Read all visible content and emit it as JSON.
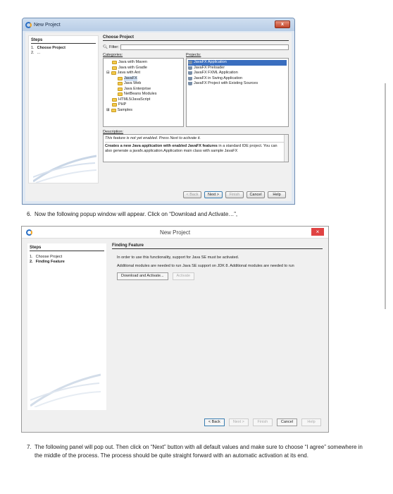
{
  "window1": {
    "title": "New Project",
    "close_label": "x",
    "steps_header": "Steps",
    "steps": [
      {
        "num": "1.",
        "label": "Choose Project"
      },
      {
        "num": "2.",
        "label": "..."
      }
    ],
    "main_header": "Choose Project",
    "filter_label": "Filter:",
    "categories_label": "Categories:",
    "projects_label": "Projects:",
    "categories": [
      "Java with Maven",
      "Java with Gradle",
      "Java with Ant",
      "JavaFX",
      "Java Web",
      "Java Enterprise",
      "NetBeans Modules",
      "HTML5/JavaScript",
      "PHP",
      "Samples"
    ],
    "projects": [
      "JavaFX Application",
      "JavaFX Preloader",
      "JavaFX FXML Application",
      "JavaFX in Swing Application",
      "JavaFX Project with Existing Sources"
    ],
    "description_label": "Description:",
    "description_note": "This feature is not yet enabled. Press Next to activate it.",
    "description_bold": "Creates a new Java application with enabled JavaFX features",
    "description_rest": " in a standard IDE project. You can also generate a javafx.application.Application main class with sample JavaFX",
    "buttons": {
      "back": "< Back",
      "next": "Next >",
      "finish": "Finish",
      "cancel": "Cancel",
      "help": "Help"
    }
  },
  "step6": {
    "num": "6.",
    "text": "Now the following popup window will appear. Click on “Download and Activate…”,"
  },
  "window2": {
    "title": "New Project",
    "close_label": "×",
    "steps_header": "Steps",
    "steps": [
      {
        "num": "1.",
        "label": "Choose Project"
      },
      {
        "num": "2.",
        "label": "Finding Feature"
      }
    ],
    "main_header": "Finding Feature",
    "line1": "In order to use this functionality, support for Java SE must be activated.",
    "line2": "Additional modules are needed to run Java SE support on JDK 8. Additional modules are needed to run",
    "download_label": "Download and Activate...",
    "activate_label": "Activate",
    "buttons": {
      "back": "< Back",
      "next": "Next >",
      "finish": "Finish",
      "cancel": "Cancel",
      "help": "Help"
    }
  },
  "step7": {
    "num": "7.",
    "text": "The following panel will pop out. Then click on “Next” button with all default values and make sure to choose “I agree” somewhere in the middle of the process. The process should be quite straight forward with an automatic activation at its end."
  }
}
